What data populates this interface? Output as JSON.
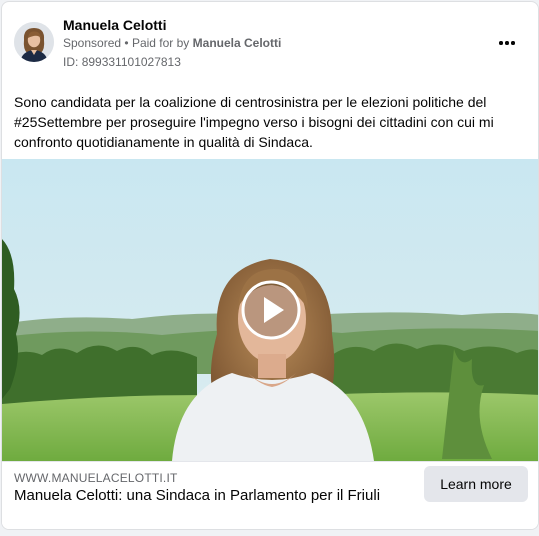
{
  "ad": {
    "advertiser": "Manuela Celotti",
    "sponsored_label": "Sponsored",
    "separator": "•",
    "paid_for_by_label": "Paid for by",
    "paid_for_by_name": "Manuela Celotti",
    "ad_id_label": "ID:",
    "ad_id": "899331101027813",
    "more_icon": "more-horizontal-icon",
    "body": "Sono candidata per la coalizione di centrosinistra per le elezioni politiche del #25Settembre per proseguire l'impegno verso i bisogni dei cittadini con cui mi confronto quotidianamente in qualità di Sindaca.",
    "media": {
      "type": "video",
      "play_icon": "play-icon"
    },
    "link": {
      "domain": "WWW.MANUELACELOTTI.IT",
      "headline": "Manuela Celotti: una Sindaca in Parlamento per il Friuli",
      "cta": "Learn more"
    }
  },
  "colors": {
    "text_primary": "#050505",
    "text_secondary": "#65676b",
    "button_bg": "#e4e6eb",
    "card_bg": "#ffffff"
  }
}
